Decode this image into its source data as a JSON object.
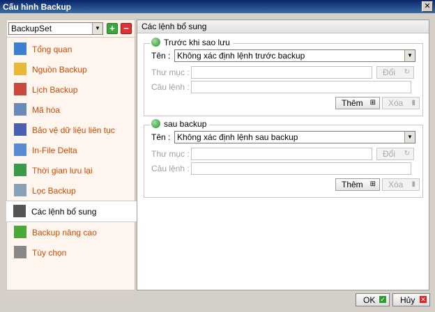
{
  "window": {
    "title": "Cấu hình Backup",
    "close_glyph": "✕"
  },
  "sidebar": {
    "backup_set": "BackupSet",
    "add_glyph": "+",
    "remove_glyph": "−",
    "items": [
      {
        "label": "Tổng quan",
        "icon": "overview-icon",
        "color": "#3a7fd1"
      },
      {
        "label": "Nguồn Backup",
        "icon": "folder-icon",
        "color": "#e8b938"
      },
      {
        "label": "Lịch Backup",
        "icon": "calendar-icon",
        "color": "#c84a3a"
      },
      {
        "label": "Mã hóa",
        "icon": "encryption-icon",
        "color": "#6a8ab8"
      },
      {
        "label": "Bảo vệ dữ liệu liên tục",
        "icon": "shield-icon",
        "color": "#4a5fb0"
      },
      {
        "label": "In-File Delta",
        "icon": "document-icon",
        "color": "#5a8ad0"
      },
      {
        "label": "Thời gian lưu lại",
        "icon": "recycle-icon",
        "color": "#3a9a4a"
      },
      {
        "label": "Lọc Backup",
        "icon": "filter-icon",
        "color": "#8aa0b8"
      },
      {
        "label": "Các lệnh bổ sung",
        "icon": "command-icon",
        "color": "#555555"
      },
      {
        "label": "Backup nâng cao",
        "icon": "advanced-icon",
        "color": "#4aa83a"
      },
      {
        "label": "Tùy chọn",
        "icon": "options-icon",
        "color": "#888888"
      }
    ],
    "active_index": 8
  },
  "main": {
    "header": "Các lệnh bổ sung",
    "before": {
      "title": "Trước khi sao lưu",
      "name_label": "Tên :",
      "name_value": "Không xác định lệnh trước backup",
      "folder_label": "Thư mục :",
      "command_label": "Câu lệnh :",
      "change_label": "Đổi",
      "add_label": "Thêm",
      "delete_label": "Xóa"
    },
    "after": {
      "title": "sau backup",
      "name_label": "Tên :",
      "name_value": "Không xác định lệnh sau backup",
      "folder_label": "Thư mục :",
      "command_label": "Câu lệnh :",
      "change_label": "Đổi",
      "add_label": "Thêm",
      "delete_label": "Xóa"
    }
  },
  "footer": {
    "ok_label": "OK",
    "cancel_label": "Hủy"
  }
}
